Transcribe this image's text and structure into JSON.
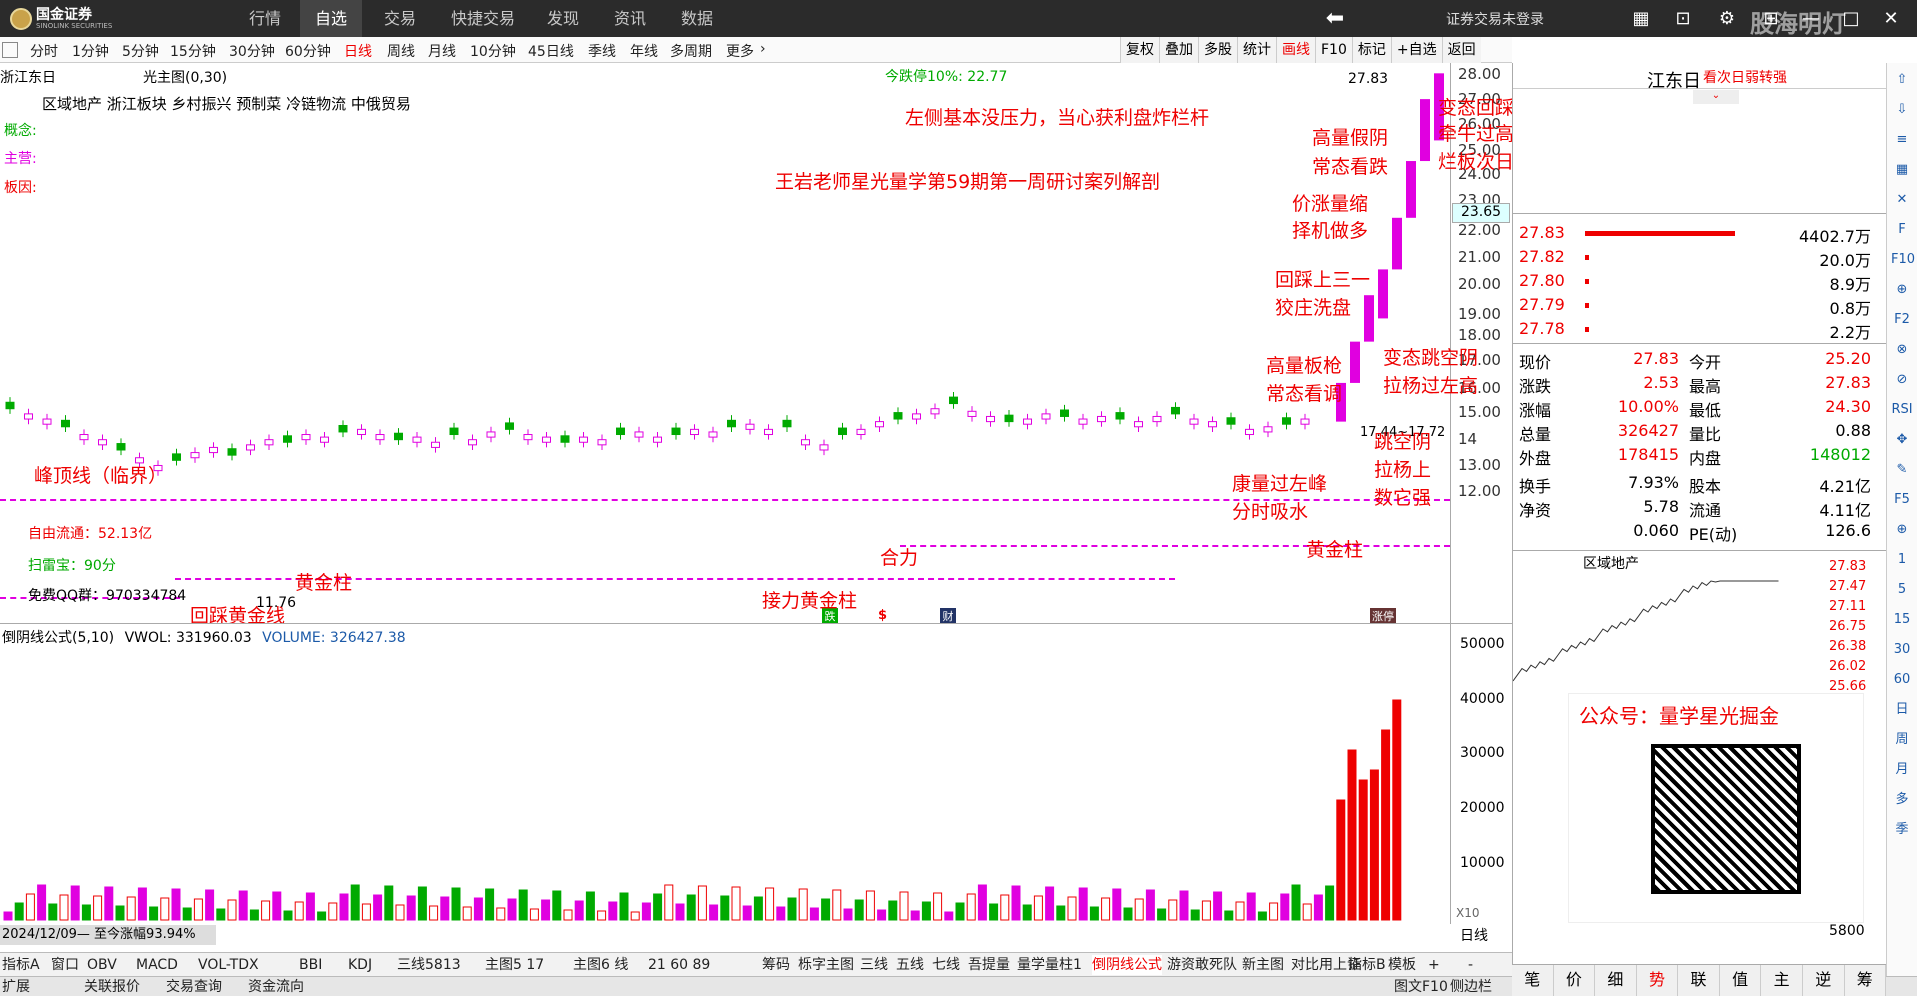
{
  "topbar": {
    "brand": "国金证券",
    "brand_en": "SINOLINK SECURITIES",
    "nav": [
      "行情",
      "自选",
      "交易",
      "快捷交易",
      "发现",
      "资讯",
      "数据"
    ],
    "active": "自选",
    "login_status": "证券交易未登录",
    "watermark": "股海明灯"
  },
  "periods": [
    "分时",
    "1分钟",
    "5分钟",
    "15分钟",
    "30分钟",
    "60分钟",
    "日线",
    "周线",
    "月线",
    "10分钟",
    "45日线",
    "季线",
    "年线",
    "多周期",
    "更多"
  ],
  "active_period": "日线",
  "right_tools": [
    "复权",
    "叠加",
    "多股",
    "统计",
    "画线",
    "F10",
    "标记",
    "+自选",
    "返回"
  ],
  "chart": {
    "stock_name": "浙江东日",
    "indicator": "光主图(0,30)",
    "limit_down": "今跌停10%: 22.77",
    "sectors": "区域地产   浙江板块   乡村振兴 预制菜 冷链物流 中俄贸易",
    "tags": {
      "concept": "概念:",
      "main_business": "主营:",
      "board_reason": "板因:"
    },
    "price_ticks": [
      "28.00",
      "27.00",
      "26.00",
      "25.00",
      "24.00",
      "23.00",
      "22.00",
      "21.00",
      "20.00",
      "19.00",
      "18.00",
      "17.00",
      "16.00",
      "15.00",
      "14",
      "13.00",
      "12.00"
    ],
    "current_price_tag": "23.65",
    "high_label": "27.83",
    "low_label": "11.76",
    "range_label": "17.44~17.72",
    "float_cap": "自由流通：52.13亿",
    "scan": "扫雷宝：90分",
    "qq": "免费QQ群：970334784",
    "markers": [
      "跌",
      "$",
      "财",
      "涨停"
    ]
  },
  "annotations": {
    "title_line": "王岩老师星光量学第59期第一周研讨案列解剖",
    "left_pressure": "左侧基本没压力，当心获利盘炸栏杆",
    "fake_yin_1": "高量假阴",
    "fake_yin_2": "常态看跌",
    "var_step_1": "变态回踩",
    "var_step_2": "牵牛过高量",
    "var_step_3": "烂板次日观察竞价",
    "price_up_1": "价涨量缩",
    "price_up_2": "择机做多",
    "step3_1": "回踩上三一",
    "step3_2": "狡庄洗盘",
    "gun_1": "高量板枪",
    "gun_2": "常态看调",
    "jump_1": "变态跳空阴",
    "jump_2": "拉杨过左高",
    "jump2_1": "跳空阴",
    "jump2_2": "拉杨上",
    "jump2_3": "数它强",
    "peak_line": "峰顶线（临界）",
    "vol_over": "康量过左峰",
    "absorb": "分时吸水",
    "gold_1": "黄金柱",
    "gold_2": "回踩黄金线",
    "gold_3": "接力黄金柱",
    "gold_4": "黄金柱",
    "heli": "合力"
  },
  "volume": {
    "header": "倒阴线公式(5,10)",
    "vwol": "VWOL: 331960.03",
    "volume_label": "VOLUME: 326427.38",
    "ticks": [
      "50000",
      "40000",
      "30000",
      "20000",
      "10000"
    ],
    "unit": "X10",
    "date_label": "2024/12/09— 至今涨幅93.94%",
    "period": "日线"
  },
  "quote": {
    "name": "江东日",
    "hint": "看次日弱转强",
    "asks": [
      {
        "p": "27.83",
        "v": "4402.7万"
      },
      {
        "p": "27.82",
        "v": "20.0万"
      },
      {
        "p": "27.80",
        "v": "8.9万"
      },
      {
        "p": "27.79",
        "v": "0.8万"
      },
      {
        "p": "27.78",
        "v": "2.2万"
      }
    ],
    "rows": [
      {
        "k1": "现价",
        "v1": "27.83",
        "k2": "今开",
        "v2": "25.20"
      },
      {
        "k1": "涨跌",
        "v1": "2.53",
        "k2": "最高",
        "v2": "27.83"
      },
      {
        "k1": "涨幅",
        "v1": "10.00%",
        "k2": "最低",
        "v2": "24.30"
      },
      {
        "k1": "总量",
        "v1": "326427",
        "k2": "量比",
        "v2": "0.88"
      },
      {
        "k1": "外盘",
        "v1": "178415",
        "k2": "内盘",
        "v2": "148012"
      },
      {
        "k1": "换手",
        "v1": "7.93%",
        "k2": "股本",
        "v2": "4.21亿"
      },
      {
        "k1": "净资",
        "v1": "5.78",
        "k2": "流通",
        "v2": "4.11亿"
      },
      {
        "k1": "",
        "v1": "0.060",
        "k2": "PE(动)",
        "v2": "126.6"
      }
    ],
    "mini_title": "区域地产",
    "mini_ticks": [
      "27.83",
      "27.47",
      "27.11",
      "26.75",
      "26.38",
      "26.02",
      "25.66"
    ],
    "mini_vol": "5800"
  },
  "promo": {
    "title": "公众号：量学星光掘金"
  },
  "bottom_tabs": [
    "指标A",
    "窗口",
    "OBV",
    "MACD",
    "VOL-TDX",
    "BBI",
    "KDJ",
    "三线5813",
    "主图5 17",
    "主图6 线",
    "21 60 89",
    "筹码",
    "栎字主图",
    "三线",
    "五线",
    "七线",
    "吾提量",
    "量学量柱1",
    "倒阴线公式",
    "游资敢死队",
    "新主图",
    "对比用上证"
  ],
  "active_tab": "倒阴线公式",
  "bottom_right": [
    "指标B",
    "模板",
    "+",
    "-"
  ],
  "bottom_row2": [
    "扩展",
    "关联报价",
    "交易查询",
    "资金流向"
  ],
  "bottom_row2_right": [
    "图文F10",
    "侧边栏"
  ],
  "right_bottom_tabs": [
    "笔",
    "价",
    "细",
    "势",
    "联",
    "值",
    "主",
    "逆",
    "筹"
  ],
  "right_bottom_active": "势",
  "sidebar": [
    "⇧",
    "⇩",
    "≡",
    "▦",
    "✕",
    "F",
    "F10",
    "⊕",
    "F2",
    "⊗",
    "⊘",
    "RSI",
    "✥",
    "✎",
    "F5",
    "⊕",
    "1",
    "5",
    "15",
    "30",
    "60",
    "日",
    "周",
    "月",
    "多",
    "季"
  ],
  "colors": {
    "up": "#ff00ff",
    "down": "#00a000",
    "limit": "#ff0000",
    "accent": "#e00000"
  }
}
